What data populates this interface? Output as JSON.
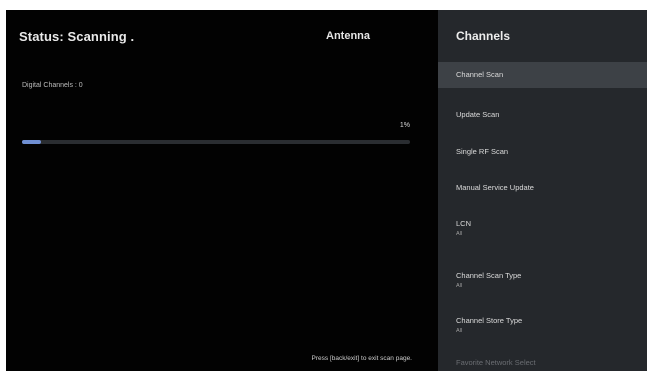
{
  "scan": {
    "status": "Status: Scanning .",
    "source": "Antenna",
    "digital_channels": "Digital Channels : 0",
    "progress_label": "1%",
    "progress_fraction": 0.05,
    "hint": "Press [back/exit] to exit scan page.",
    "progress_color": "#6f8fd3"
  },
  "menu": {
    "title": "Channels",
    "items": [
      {
        "label": "Channel Scan",
        "value": "",
        "selected": true
      },
      {
        "label": "Update Scan",
        "value": ""
      },
      {
        "label": "Single RF Scan",
        "value": ""
      },
      {
        "label": "Manual Service Update",
        "value": ""
      },
      {
        "label": "LCN",
        "value": "All"
      },
      {
        "label": "Channel Scan Type",
        "value": "All"
      },
      {
        "label": "Channel Store Type",
        "value": "All"
      },
      {
        "label": "Favorite Network Select",
        "value": ""
      }
    ]
  }
}
